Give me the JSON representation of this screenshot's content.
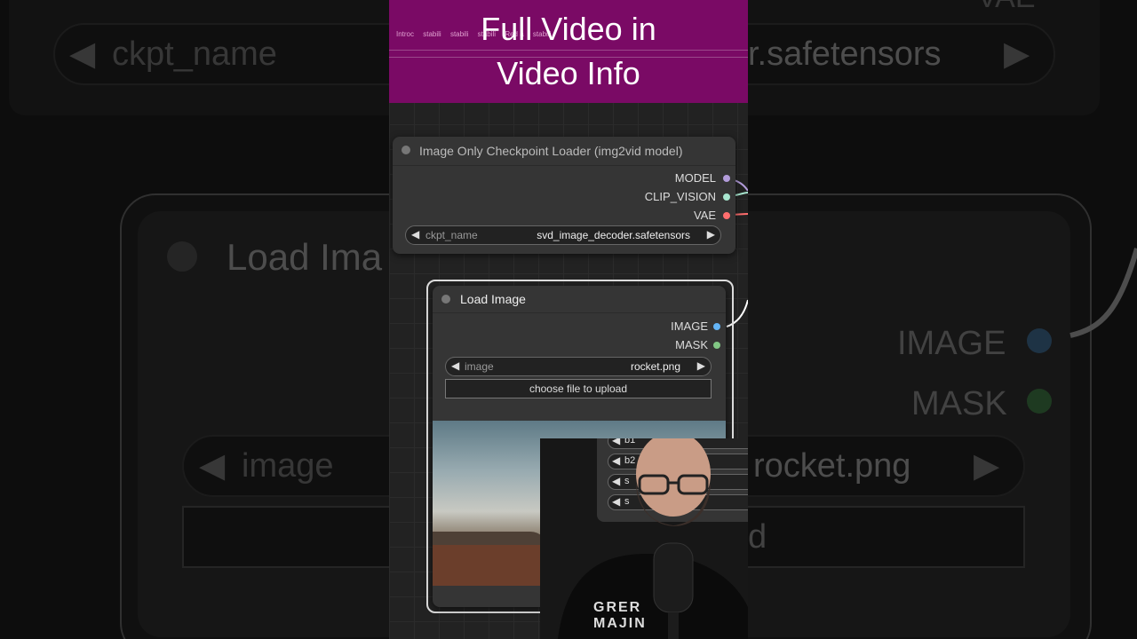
{
  "banner": {
    "line1": "Full Video in",
    "line2": "Video Info",
    "tabs": [
      "Introc",
      "stabili",
      "stabili",
      "stabili",
      "Red a",
      "stabili"
    ]
  },
  "background": {
    "ckpt_label": "ckpt_name",
    "ckpt_value": "r.safetensors",
    "node_title": "Load Ima",
    "image_output": "IMAGE",
    "mask_output": "MASK",
    "image_label": "image",
    "image_value": "rocket.png",
    "upload_fragment": "d",
    "vae_fragment": "VAE"
  },
  "checkpoint_node": {
    "title": "Image Only Checkpoint Loader (img2vid model)",
    "outputs": [
      {
        "label": "MODEL",
        "color": "#b39ddb"
      },
      {
        "label": "CLIP_VISION",
        "color": "#a8e6cf"
      },
      {
        "label": "VAE",
        "color": "#ff6e6e"
      }
    ],
    "widget_label": "ckpt_name",
    "widget_value": "svd_image_decoder.safetensors"
  },
  "load_image_node": {
    "title": "Load Image",
    "outputs": [
      {
        "label": "IMAGE",
        "color": "#64b5f6"
      },
      {
        "label": "MASK",
        "color": "#81c784"
      }
    ],
    "widget_label": "image",
    "widget_value": "rocket.png",
    "upload_button": "choose file to upload"
  },
  "partial_node": {
    "widgets": [
      "b1",
      "b2",
      "s",
      "s"
    ]
  },
  "shirt_text": "GRER MAJIN"
}
